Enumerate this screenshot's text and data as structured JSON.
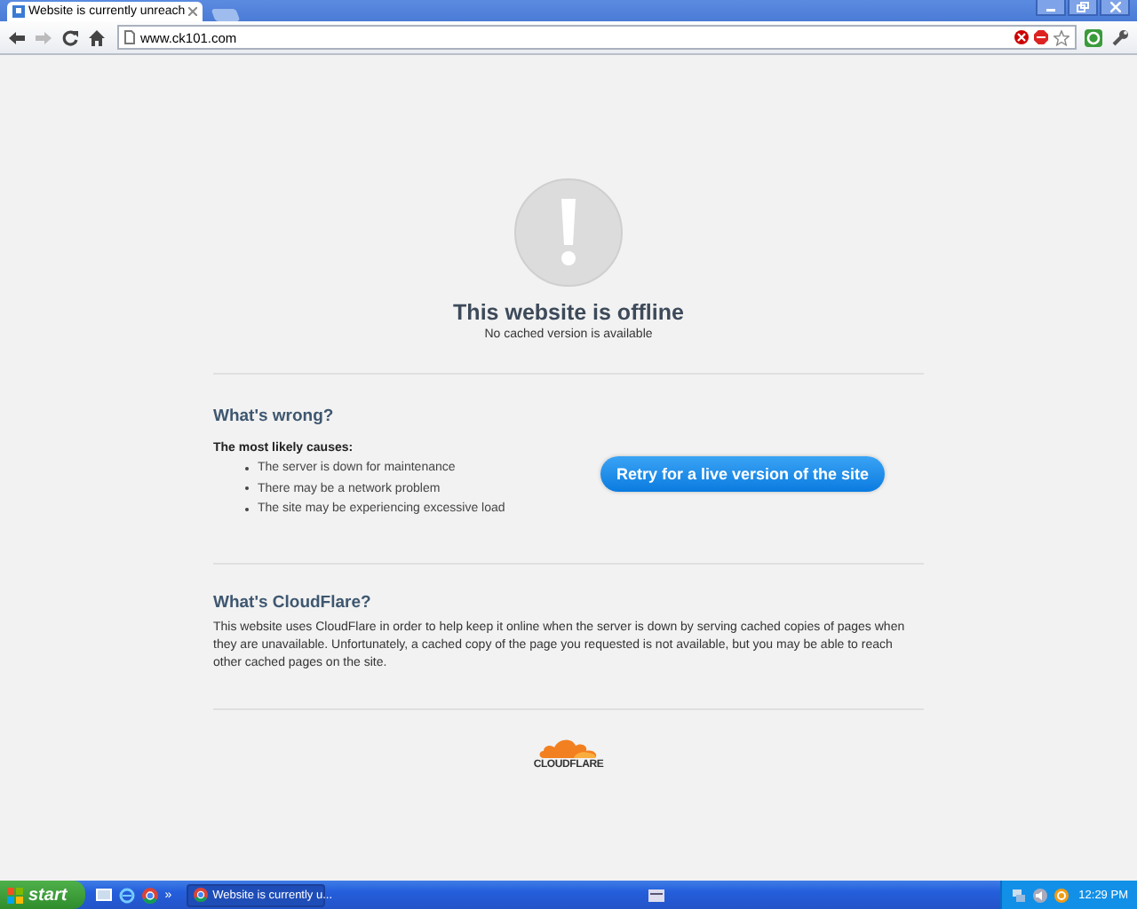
{
  "browser": {
    "tab_title": "Website is currently unreach",
    "url": "www.ck101.com"
  },
  "page": {
    "title": "This website is offline",
    "subtitle": "No cached version is available",
    "wrong_heading": "What's wrong?",
    "causes_heading": "The most likely causes:",
    "causes": [
      "The server is down for maintenance",
      "There may be a network problem",
      "The site may be experiencing excessive load"
    ],
    "retry_button": "Retry for a live version of the site",
    "about_heading": "What's CloudFlare?",
    "about_text": "This website uses CloudFlare in order to help keep it online when the server is down by serving cached copies of pages when they are unavailable. Unfortunately, a cached copy of the page you requested is not available, but you may be able to reach other cached pages on the site.",
    "logo_text": "CLOUDFLARE"
  },
  "taskbar": {
    "start": "start",
    "more": "»",
    "task": "Website is currently u...",
    "clock": "12:29 PM"
  }
}
